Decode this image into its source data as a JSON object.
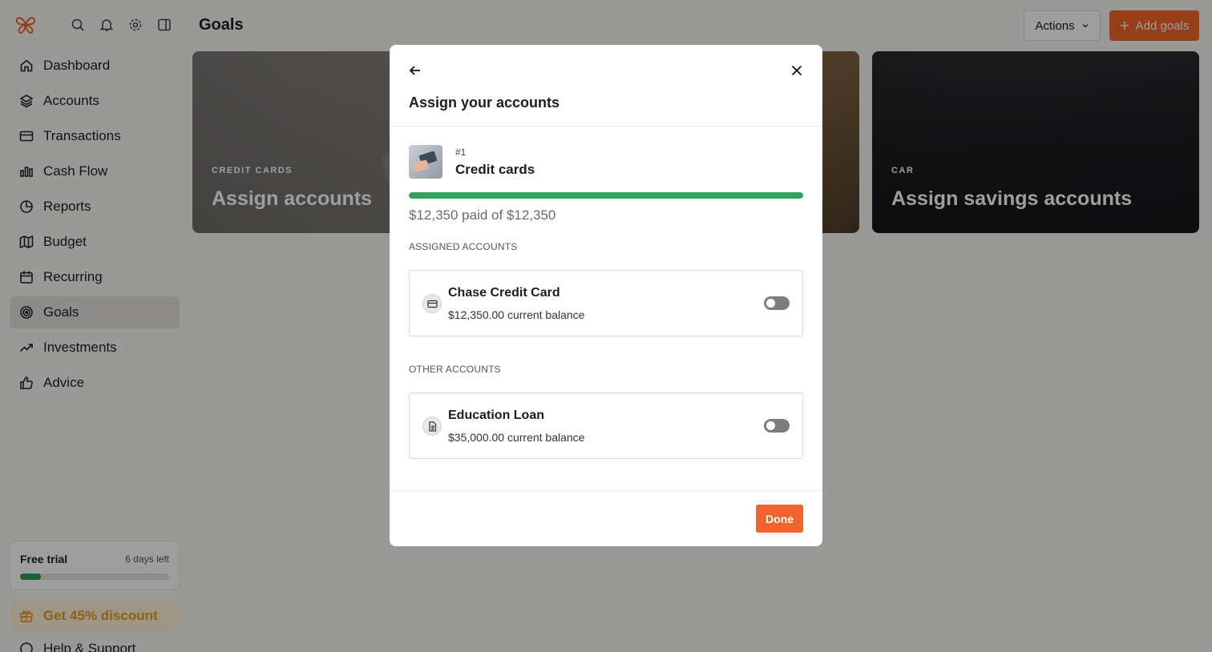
{
  "header": {
    "title": "Goals",
    "actions_label": "Actions",
    "add_goals_label": "Add goals"
  },
  "sidebar": {
    "items": [
      {
        "label": "Dashboard",
        "icon": "home-icon"
      },
      {
        "label": "Accounts",
        "icon": "layers-icon"
      },
      {
        "label": "Transactions",
        "icon": "credit-card-icon"
      },
      {
        "label": "Cash Flow",
        "icon": "bar-chart-icon"
      },
      {
        "label": "Reports",
        "icon": "pie-chart-icon"
      },
      {
        "label": "Budget",
        "icon": "map-icon"
      },
      {
        "label": "Recurring",
        "icon": "calendar-icon"
      },
      {
        "label": "Goals",
        "icon": "target-icon",
        "active": true
      },
      {
        "label": "Investments",
        "icon": "trending-up-icon"
      },
      {
        "label": "Advice",
        "icon": "thumbs-up-icon"
      }
    ],
    "trial": {
      "title": "Free trial",
      "days_left": "6 days left",
      "progress": 0.14
    },
    "discount_label": "Get 45% discount",
    "help_label": "Help & Support"
  },
  "cards": [
    {
      "category": "CREDIT CARDS",
      "title": "Assign accounts"
    },
    {
      "category": "CAR",
      "title": "Assign savings accounts"
    }
  ],
  "modal": {
    "title": "Assign your accounts",
    "goal_number": "#1",
    "goal_name": "Credit cards",
    "progress": 1.0,
    "paid_text": "$12,350 paid of $12,350",
    "assigned_label": "ASSIGNED ACCOUNTS",
    "assigned": [
      {
        "name": "Chase Credit Card",
        "balance": "$12,350.00 current balance",
        "enabled": false
      }
    ],
    "other_label": "OTHER ACCOUNTS",
    "other": [
      {
        "name": "Education Loan",
        "balance": "$35,000.00 current balance",
        "enabled": false
      }
    ],
    "done_label": "Done"
  },
  "colors": {
    "accent": "#f1642b",
    "progress": "#31a35e",
    "trial_progress": "#2e9b5b"
  }
}
